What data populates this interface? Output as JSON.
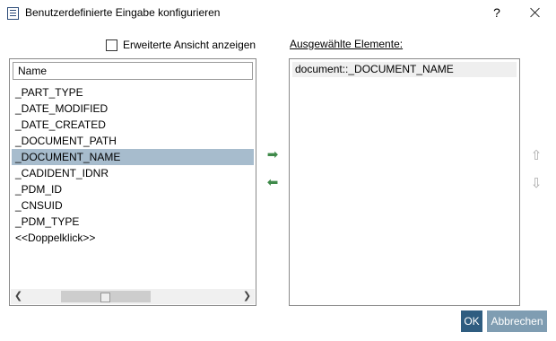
{
  "window": {
    "title": "Benutzerdefinierte Eingabe konfigurieren",
    "help_label": "?"
  },
  "options": {
    "extended_view_label": "Erweiterte Ansicht anzeigen",
    "extended_view_checked": false
  },
  "available_list": {
    "header": "Name",
    "items": [
      "_PART_TYPE",
      "_DATE_MODIFIED",
      "_DATE_CREATED",
      "_DOCUMENT_PATH",
      "_DOCUMENT_NAME",
      "_CADIDENT_IDNR",
      "_PDM_ID",
      "_CNSUID",
      "_PDM_TYPE",
      "<<Doppelklick>>"
    ],
    "selected_item": "_DOCUMENT_NAME"
  },
  "selected_list": {
    "label": "Ausgewählte Elemente:",
    "items": [
      "document::_DOCUMENT_NAME"
    ]
  },
  "buttons": {
    "ok": "OK",
    "cancel": "Abbrechen"
  },
  "icons": {
    "add": "arrow-right-icon",
    "remove": "arrow-left-icon",
    "move_up": "arrow-up-icon",
    "move_down": "arrow-down-icon",
    "add_color": "#3f8a4a",
    "selection_color": "#a7bccd",
    "ok_color": "#2f5d80",
    "cancel_color": "#7f9db2"
  }
}
